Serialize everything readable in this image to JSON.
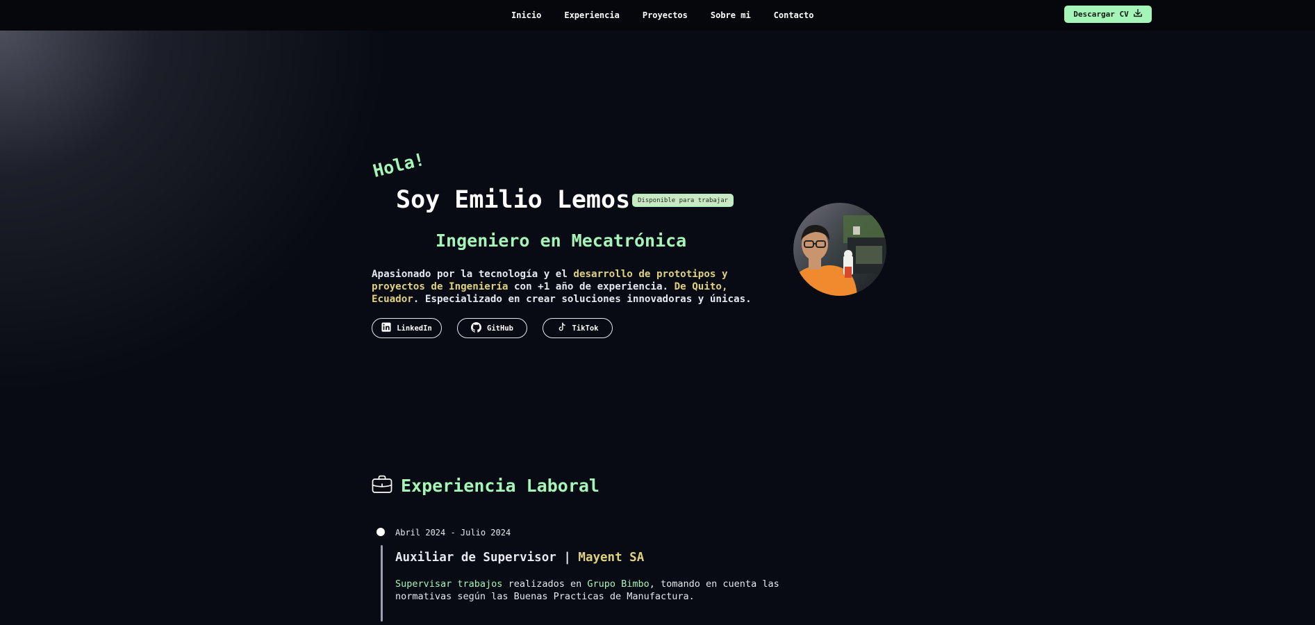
{
  "nav": {
    "items": [
      {
        "label": "Inicio"
      },
      {
        "label": "Experiencia"
      },
      {
        "label": "Proyectos"
      },
      {
        "label": "Sobre mi"
      },
      {
        "label": "Contacto"
      }
    ],
    "cv_button_label": "Descargar CV",
    "cv_button_icon": "download-icon"
  },
  "hero": {
    "greeting": "Hola!",
    "name": "Soy Emilio Lemos",
    "badge": "Disponible para trabajar",
    "role": "Ingeniero en Mecatrónica",
    "bio": {
      "part1": "Apasionado por la tecnología y el ",
      "highlight1": "desarrollo de prototipos y proyectos de Ingeniería",
      "part2": " con +1 año de experiencia. ",
      "highlight2": "De Quito, Ecuador",
      "part3": ". Especializado en crear soluciones innovadoras y únicas."
    },
    "socials": [
      {
        "label": "LinkedIn",
        "icon": "linkedin-icon"
      },
      {
        "label": "GitHub",
        "icon": "github-icon"
      },
      {
        "label": "TikTok",
        "icon": "tiktok-icon"
      }
    ]
  },
  "experience": {
    "title": "Experiencia Laboral",
    "icon": "briefcase-icon",
    "items": [
      {
        "date": "Abril 2024 - Julio 2024",
        "position": "Auxiliar de Supervisor",
        "separator": " | ",
        "company": "Mayent SA",
        "desc": {
          "g1": "Supervisar trabajos",
          "t1": " realizados en ",
          "g2": "Grupo Bimbo",
          "t2": ", tomando en cuenta las normativas según las Buenas Practicas de Manufactura."
        }
      }
    ]
  },
  "colors": {
    "accent": "#a6f5b8",
    "highlight": "#e0d27c",
    "background": "#080b13"
  }
}
